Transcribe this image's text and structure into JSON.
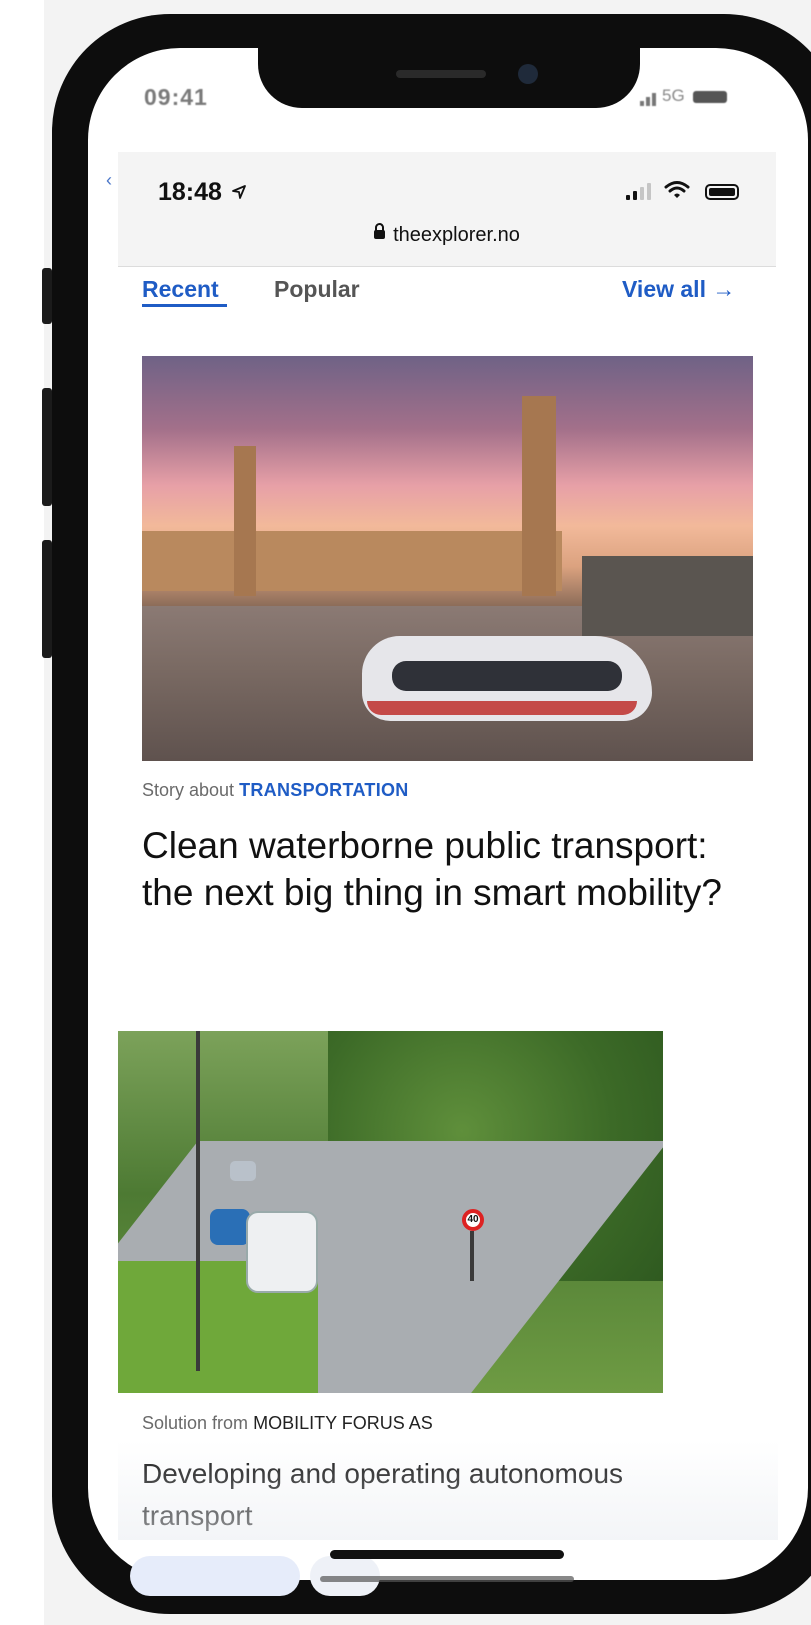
{
  "device": {
    "outer_time": "09:41",
    "outer_network": "5G"
  },
  "browser": {
    "time": "18:48",
    "url": "theexplorer.no"
  },
  "tabs": {
    "recent": "Recent",
    "popular": "Popular",
    "view_all": "View all →"
  },
  "articles": [
    {
      "prefix": "Story about",
      "category": "TRANSPORTATION",
      "title": "Clean waterborne public transport: the next big thing in smart mobility?"
    },
    {
      "prefix": "Solution from",
      "company": "MOBILITY FORUS AS",
      "title": "Developing and operating autonomous transport"
    }
  ],
  "image2": {
    "speed_limit": "40"
  },
  "colors": {
    "accent": "#1f5cc5",
    "phone_frame": "#0d0d0d"
  }
}
